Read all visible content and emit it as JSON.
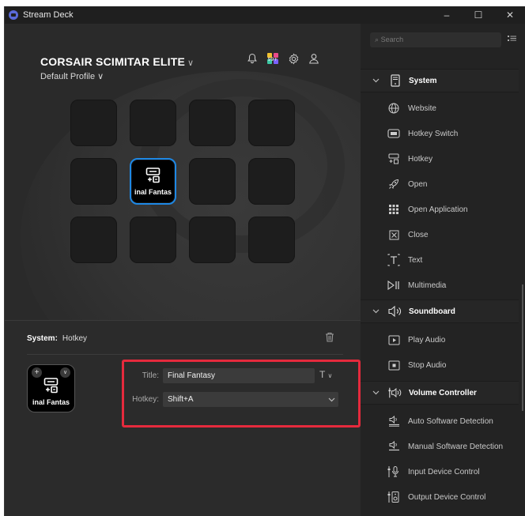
{
  "window": {
    "title": "Stream Deck",
    "min": "–",
    "max": "☐",
    "close": "✕"
  },
  "device": {
    "name": "CORSAIR SCIMITAR ELITE",
    "name_chevron": "∨",
    "profile": "Default Profile ∨"
  },
  "topbar": {
    "icons": [
      "bell-icon",
      "plugin-store-icon",
      "settings-icon",
      "account-icon"
    ],
    "badge": "99+"
  },
  "deck": {
    "active_key": {
      "label": "inal Fantas",
      "icon": "hotkey-icon"
    }
  },
  "inspector": {
    "category": "System:",
    "action": "Hotkey",
    "preview_label": "inal Fantas",
    "title_label": "Title:",
    "title_value": "Final Fantasy",
    "hotkey_label": "Hotkey:",
    "hotkey_value": "Shift+A",
    "plus": "+",
    "chevron": "∨",
    "text_style": "T"
  },
  "panel": {
    "search_placeholder": "Search",
    "categories": [
      {
        "name": "System",
        "items": [
          "Website",
          "Hotkey Switch",
          "Hotkey",
          "Open",
          "Open Application",
          "Close",
          "Text",
          "Multimedia"
        ]
      },
      {
        "name": "Soundboard",
        "items": [
          "Play Audio",
          "Stop Audio"
        ]
      },
      {
        "name": "Volume Controller",
        "items": [
          "Auto Software Detection",
          "Manual Software Detection",
          "Input Device Control",
          "Output Device Control"
        ]
      }
    ]
  },
  "colors": {
    "accent": "#1e88e5",
    "highlight": "#e52a3d",
    "background": "#2b2b2b",
    "panel": "#232323"
  }
}
